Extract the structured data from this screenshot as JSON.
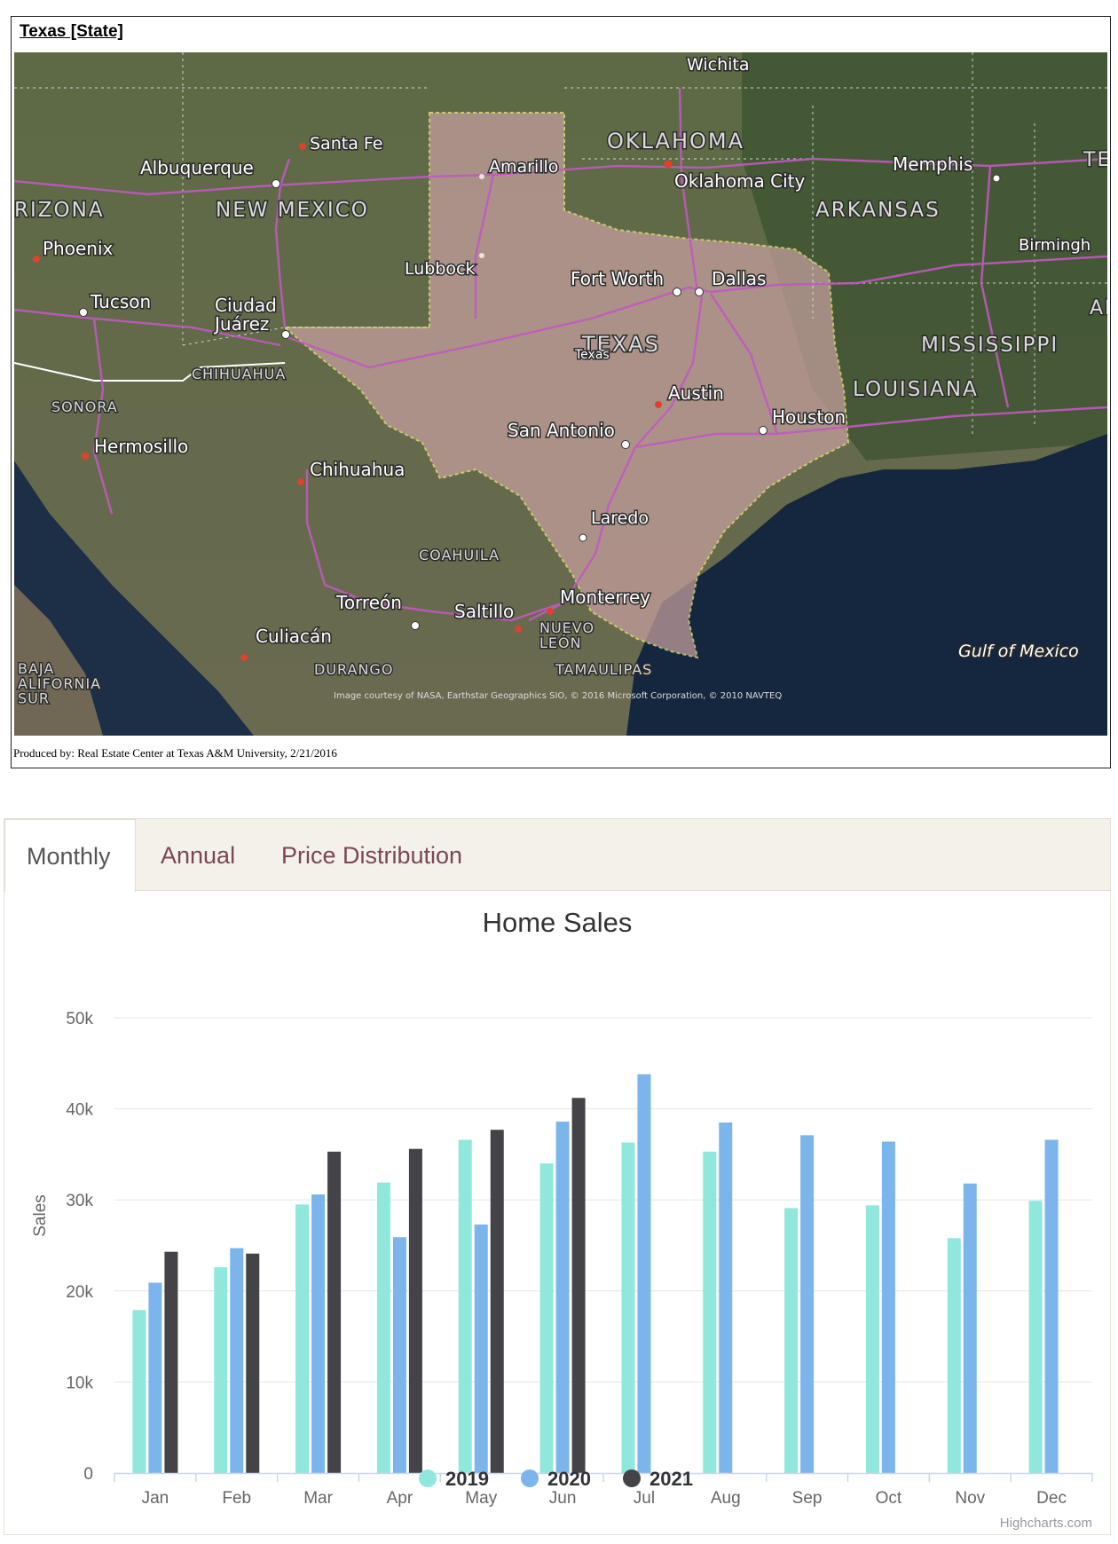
{
  "map": {
    "title": "Texas [State]",
    "credit": "Produced by: Real Estate Center at Texas A&M University, 2/21/2016",
    "imagery_credit": "Image courtesy of NASA, Earthstar Geographics SIO, © 2016 Microsoft Corporation, © 2010 NAVTEQ",
    "labels": {
      "wichita": "Wichita",
      "santa_fe": "Santa Fe",
      "albuquerque": "Albuquerque",
      "amarillo": "Amarillo",
      "oklahoma": "OKLAHOMA",
      "oklahoma_city": "Oklahoma City",
      "memphis": "Memphis",
      "tennessee": "TE",
      "arizona": "RIZONA",
      "new_mexico": "NEW MEXICO",
      "arkansas": "ARKANSAS",
      "phoenix": "Phoenix",
      "lubbock": "Lubbock",
      "birmingham": "Birmingh",
      "fort_worth": "Fort Worth",
      "dallas": "Dallas",
      "tucson": "Tucson",
      "ciudad_juarez": "Ciudad\nJuárez",
      "alabama": "AL",
      "texas": "TEXAS",
      "texas_marker": "Texas",
      "mississippi": "MISSISSIPPI",
      "chihuahua_region": "CHIHUAHUA",
      "sonora": "SONORA",
      "louisiana": "LOUISIANA",
      "austin": "Austin",
      "houston": "Houston",
      "hermosillo": "Hermosillo",
      "san_antonio": "San Antonio",
      "chihuahua": "Chihuahua",
      "laredo": "Laredo",
      "coahuila": "COAHUILA",
      "monterrey": "Monterrey",
      "torreon": "Torreón",
      "saltillo": "Saltillo",
      "nuevo_leon": "NUEVO\nLEÓN",
      "baja": "BAJA\nALIFORNIA\nSUR",
      "culiacan": "Culiacán",
      "durango": "DURANGO",
      "tamaulipas": "TAMAULIPAS",
      "gulf": "Gulf of Mexico"
    }
  },
  "tabs": [
    {
      "label": "Monthly",
      "active": true
    },
    {
      "label": "Annual",
      "active": false
    },
    {
      "label": "Price Distribution",
      "active": false
    }
  ],
  "chart_data": {
    "type": "bar",
    "title": "Home Sales",
    "ylabel": "Sales",
    "xlabel": "",
    "ylim": [
      0,
      50000
    ],
    "yticks": [
      0,
      10000,
      20000,
      30000,
      40000,
      50000
    ],
    "ytick_labels": [
      "0",
      "10k",
      "20k",
      "30k",
      "40k",
      "50k"
    ],
    "categories": [
      "Jan",
      "Feb",
      "Mar",
      "Apr",
      "May",
      "Jun",
      "Jul",
      "Aug",
      "Sep",
      "Oct",
      "Nov",
      "Dec"
    ],
    "series": [
      {
        "name": "2019",
        "color": "#90e8dc",
        "values": [
          17900,
          22600,
          29500,
          31900,
          36600,
          34000,
          36300,
          35300,
          29100,
          29400,
          25800,
          29900
        ]
      },
      {
        "name": "2020",
        "color": "#7cb5ec",
        "values": [
          20900,
          24700,
          30600,
          25900,
          27300,
          38600,
          43800,
          38500,
          37100,
          36400,
          31800,
          36600
        ]
      },
      {
        "name": "2021",
        "color": "#434348",
        "values": [
          24300,
          24100,
          35300,
          35600,
          37700,
          41200,
          null,
          null,
          null,
          null,
          null,
          null
        ]
      }
    ],
    "grid": true,
    "legend_position": "bottom-center",
    "credit": "Highcharts.com"
  }
}
